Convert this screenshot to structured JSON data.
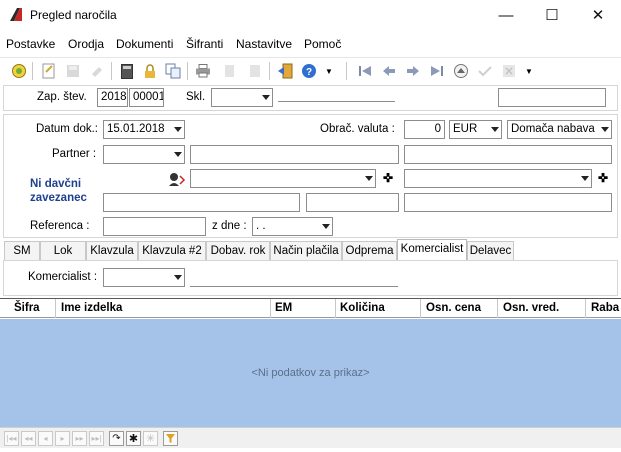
{
  "window": {
    "title": "Pregled naročila",
    "minimize": "—",
    "maximize": "☐",
    "close": "✕"
  },
  "menu": [
    "Postavke",
    "Orodja",
    "Dokumenti",
    "Šifranti",
    "Nastavitve",
    "Pomoč"
  ],
  "form": {
    "zap_stev_label": "Zap. štev.",
    "year": "2018",
    "number": "00001",
    "skl_label": "Skl.",
    "skl_value": "",
    "datum_label": "Datum dok.:",
    "datum_value": "15.01.2018",
    "valuta_label": "Obrač. valuta :",
    "valuta_amount": "0",
    "valuta_code": "EUR",
    "nabava": "Domača nabava",
    "partner_label": "Partner :",
    "partner_value": "",
    "ni_davcni_line1": "Ni davčni",
    "ni_davcni_line2": "zavezanec",
    "referenca_label": "Referenca :",
    "referenca_value": "",
    "z_dne_label": "z dne :",
    "z_dne_value": " .  ."
  },
  "tabs": [
    {
      "label": "SM",
      "active": false
    },
    {
      "label": "Lok",
      "active": false
    },
    {
      "label": "Klavzula",
      "active": false
    },
    {
      "label": "Klavzula #2",
      "active": false
    },
    {
      "label": "Dobav. rok",
      "active": false
    },
    {
      "label": "Način plačila",
      "active": false
    },
    {
      "label": "Odprema",
      "active": false
    },
    {
      "label": "Komercialist",
      "active": true
    },
    {
      "label": "Delavec",
      "active": false
    }
  ],
  "komercialist": {
    "label": "Komercialist :",
    "value": ""
  },
  "grid": {
    "columns": [
      "Šifra",
      "Ime izdelka",
      "EM",
      "Količina",
      "Osn. cena",
      "Osn. vred.",
      "Raba"
    ],
    "empty_message": "<Ni podatkov za prikaz>"
  },
  "colors": {
    "grid_background": "#a5c3e9",
    "accent_text": "#1f3f8f"
  }
}
